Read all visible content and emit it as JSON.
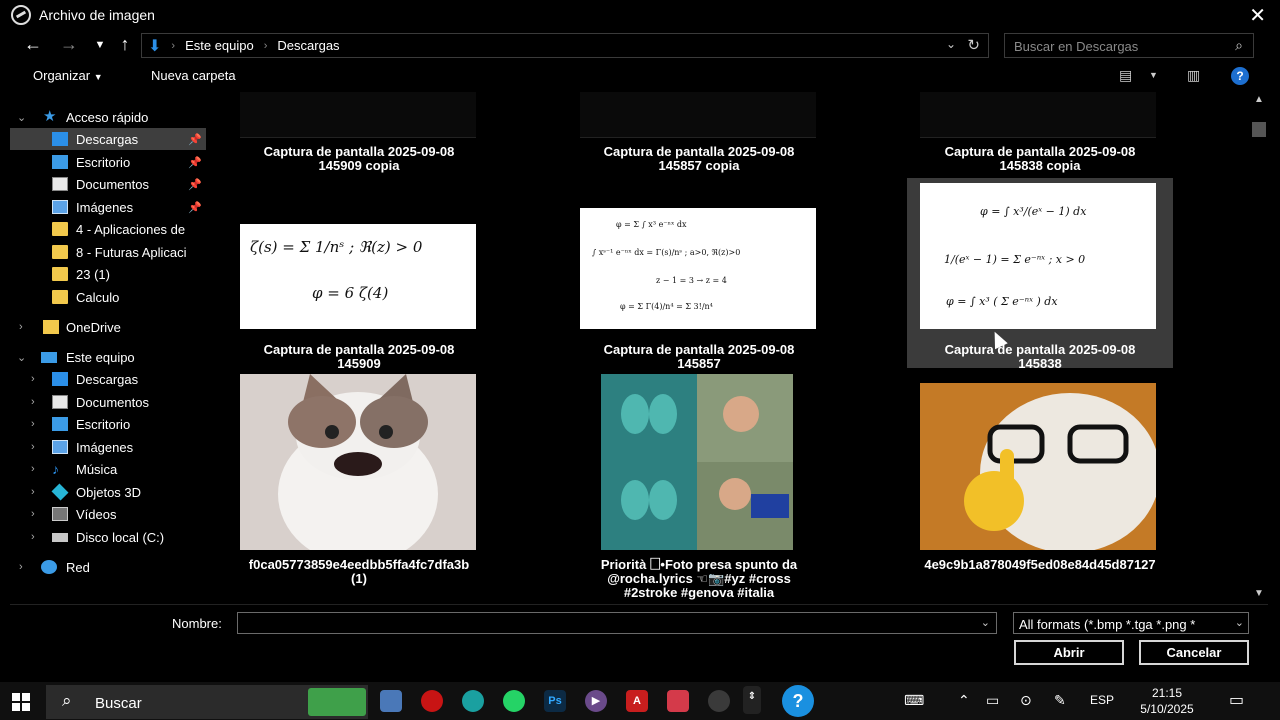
{
  "window": {
    "title": "Archivo de imagen",
    "close_glyph": "✕"
  },
  "addressbar": {
    "breadcrumbs": [
      "Este equipo",
      "Descargas"
    ],
    "search_placeholder": "Buscar en Descargas"
  },
  "toolbar": {
    "organize_label": "Organizar",
    "new_folder_label": "Nueva carpeta",
    "help_label": "?"
  },
  "sidebar": {
    "quick_access": "Acceso rápido",
    "quick_items": [
      "Descargas",
      "Escritorio",
      "Documentos",
      "Imágenes",
      "4 - Aplicaciones de",
      "8 - Futuras Aplicaci",
      "23 (1)",
      "Calculo"
    ],
    "onedrive": "OneDrive",
    "this_pc": "Este equipo",
    "pc_items": [
      "Descargas",
      "Documentos",
      "Escritorio",
      "Imágenes",
      "Música",
      "Objetos 3D",
      "Vídeos",
      "Disco local (C:)"
    ],
    "network": "Red"
  },
  "files": {
    "row0": [
      {
        "line1": "Captura de pantalla 2025-09-08",
        "line2": "145909 copia"
      },
      {
        "line1": "Captura de pantalla 2025-09-08",
        "line2": "145857 copia"
      },
      {
        "line1": "Captura de pantalla 2025-09-08",
        "line2": "145838 copia"
      }
    ],
    "row1": [
      {
        "line1": "Captura de pantalla 2025-09-08",
        "line2": "145909"
      },
      {
        "line1": "Captura de pantalla 2025-09-08",
        "line2": "145857"
      },
      {
        "line1": "Captura de pantalla 2025-09-08",
        "line2": "145838"
      }
    ],
    "row2": [
      {
        "line1": "f0ca05773859e4eedbb5ffa4fc7dfa3b",
        "line2": "(1)"
      },
      {
        "line1": "Priorità 🗌•Foto presa spunto da",
        "line2": "@rocha.lyrics ☜📷#yz #cross",
        "line3": "#2stroke #genova #italia"
      },
      {
        "line1": "4e9c9b1a878049f5ed08e84d45d87127"
      }
    ]
  },
  "bottom": {
    "name_label": "Nombre:",
    "name_value": "",
    "filter_value": "All formats (*.bmp *.tga *.png *",
    "open_label": "Abrir",
    "cancel_label": "Cancelar"
  },
  "taskbar": {
    "search_text": "Buscar",
    "lang": "ESP",
    "time": "21:15",
    "date": "5/10/2025"
  },
  "colors": {
    "accent": "#2b8fe8",
    "selection": "#3e3e3e",
    "folder": "#f2c94c",
    "help": "#1d6fd0"
  }
}
